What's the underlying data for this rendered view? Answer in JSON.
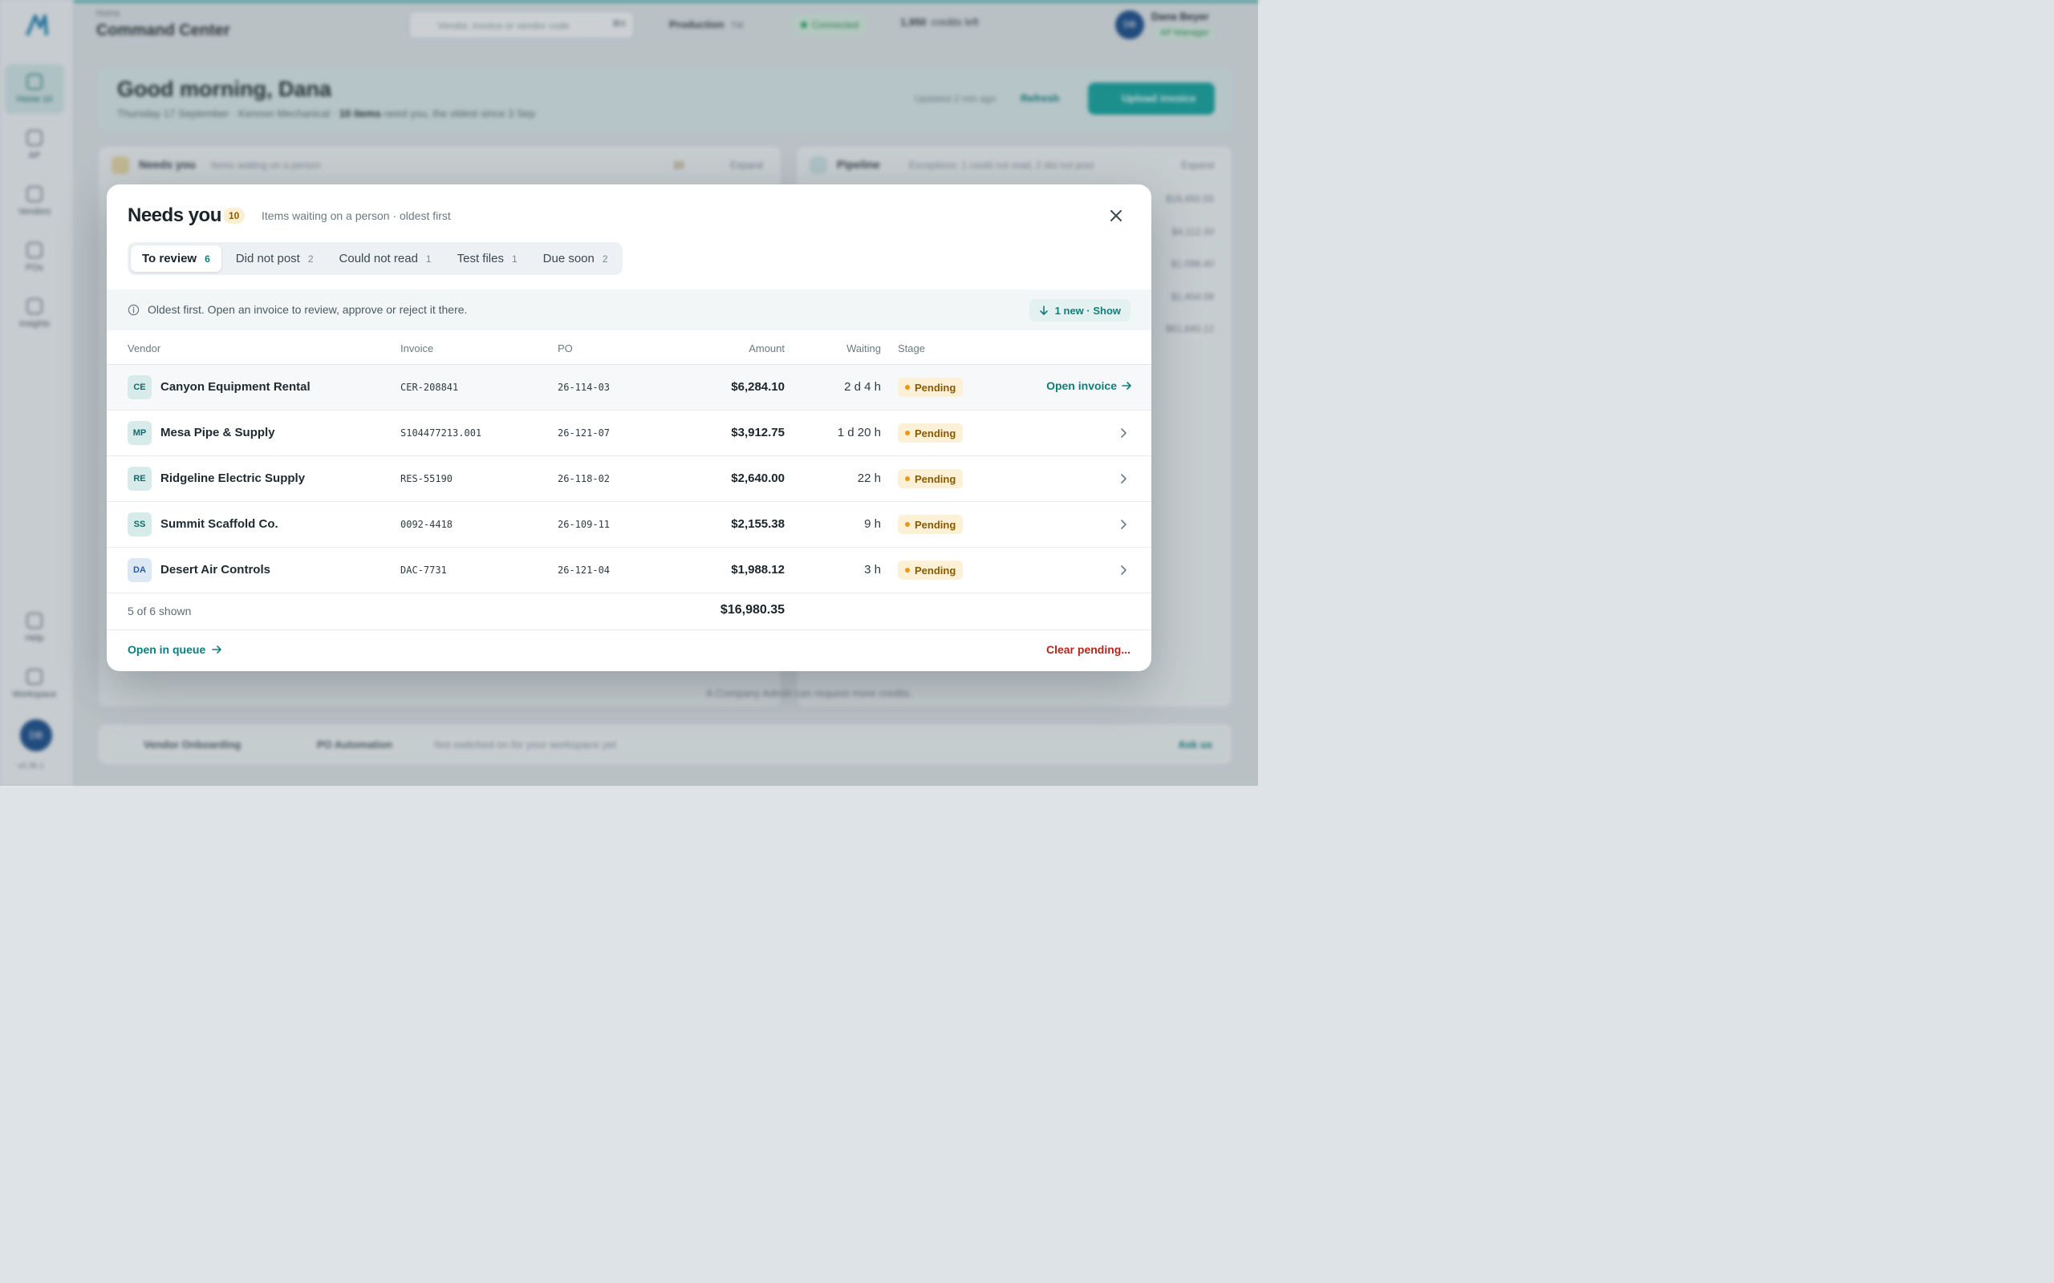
{
  "colors": {
    "accent": "#0f7e7b",
    "danger": "#b3261e",
    "pending_bg": "#fcf0d6",
    "pending_dot": "#e79b14"
  },
  "background": {
    "rail": {
      "items": [
        {
          "label": "Home",
          "count": "10",
          "icon": "home-icon"
        },
        {
          "label": "AP",
          "icon": "document-icon"
        },
        {
          "label": "Vendors",
          "icon": "users-icon"
        },
        {
          "label": "POs",
          "icon": "truck-icon"
        },
        {
          "label": "Insights",
          "icon": "person-icon"
        },
        {
          "label": "Help",
          "icon": "help-icon"
        },
        {
          "label": "Workspace",
          "icon": "briefcase-icon"
        }
      ],
      "avatar": "DB",
      "version": "v0.36.1"
    },
    "header": {
      "breadcrumb": "Home",
      "title": "Command Center",
      "search_placeholder": "Vendor, invoice or vendor code",
      "search_shortcut": "⌘K",
      "environment": "Production",
      "environment_sub": "TM",
      "connection": "Connected",
      "credits_value": "1,950",
      "credits_label": "credits left",
      "user_initials": "DB",
      "user_name": "Dana Beyer",
      "user_role": "AP Manager"
    },
    "hero": {
      "greeting": "Good morning, Dana",
      "subtitle_prefix": "Thursday 17 September · Kennon Mechanical ·",
      "subtitle_bold": "10 items",
      "subtitle_suffix": "need you, the oldest since 3 Sep",
      "updated": "Updated 2 min ago",
      "refresh": "Refresh",
      "upload": "Upload invoice"
    },
    "needs_card": {
      "title": "Needs you",
      "subtitle": "Items waiting on a person",
      "badge": "10",
      "expand": "Expand"
    },
    "pipeline_card": {
      "title": "Pipeline",
      "subtitle": "Exceptions: 1 could not read, 2 did not post",
      "expand": "Expand",
      "values": [
        "$18,450.55",
        "$4,112.30",
        "$1,098.40",
        "$1,404.08",
        "$61,840.12"
      ]
    },
    "admin_note": "A Company Admin can request more credits.",
    "bottom": {
      "vendor_onboarding": "Vendor Onboarding",
      "po_automation": "PO Automation",
      "note": "Not switched on for your workspace yet",
      "cta": "Ask us"
    }
  },
  "modal": {
    "title": "Needs you",
    "count": "10",
    "subtitle": "Items waiting on a person · oldest first",
    "tabs": [
      {
        "label": "To review",
        "count": "6",
        "active": true
      },
      {
        "label": "Did not post",
        "count": "2"
      },
      {
        "label": "Could not read",
        "count": "1"
      },
      {
        "label": "Test files",
        "count": "1"
      },
      {
        "label": "Due soon",
        "count": "2"
      }
    ],
    "info_text": "Oldest first. Open an invoice to review, approve or reject it there.",
    "new_show": "1 new · Show",
    "columns": {
      "vendor": "Vendor",
      "invoice": "Invoice",
      "po": "PO",
      "amount": "Amount",
      "waiting": "Waiting",
      "stage": "Stage"
    },
    "rows": [
      {
        "initials": "CE",
        "vendor": "Canyon Equipment Rental",
        "invoice": "CER-208841",
        "po": "26-114-03",
        "amount": "$6,284.10",
        "waiting": "2 d 4 h",
        "stage": "Pending",
        "action": "Open invoice",
        "av_bg": "#d7ecea",
        "av_fg": "#0f6b69"
      },
      {
        "initials": "MP",
        "vendor": "Mesa Pipe & Supply",
        "invoice": "S104477213.001",
        "po": "26-121-07",
        "amount": "$3,912.75",
        "waiting": "1 d 20 h",
        "stage": "Pending",
        "av_bg": "#d7ecea",
        "av_fg": "#0f6b69"
      },
      {
        "initials": "RE",
        "vendor": "Ridgeline Electric Supply",
        "invoice": "RES-55190",
        "po": "26-118-02",
        "amount": "$2,640.00",
        "waiting": "22 h",
        "stage": "Pending",
        "av_bg": "#d7ecea",
        "av_fg": "#0f6b69"
      },
      {
        "initials": "SS",
        "vendor": "Summit Scaffold Co.",
        "invoice": "0092-4418",
        "po": "26-109-11",
        "amount": "$2,155.38",
        "waiting": "9 h",
        "stage": "Pending",
        "av_bg": "#d7ecea",
        "av_fg": "#0f6b69"
      },
      {
        "initials": "DA",
        "vendor": "Desert Air Controls",
        "invoice": "DAC-7731",
        "po": "26-121-04",
        "amount": "$1,988.12",
        "waiting": "3 h",
        "stage": "Pending",
        "av_bg": "#dde8f5",
        "av_fg": "#2b5c9e"
      }
    ],
    "shown": "5 of 6 shown",
    "total": "$16,980.35",
    "open_queue": "Open in queue",
    "clear_pending": "Clear pending..."
  }
}
